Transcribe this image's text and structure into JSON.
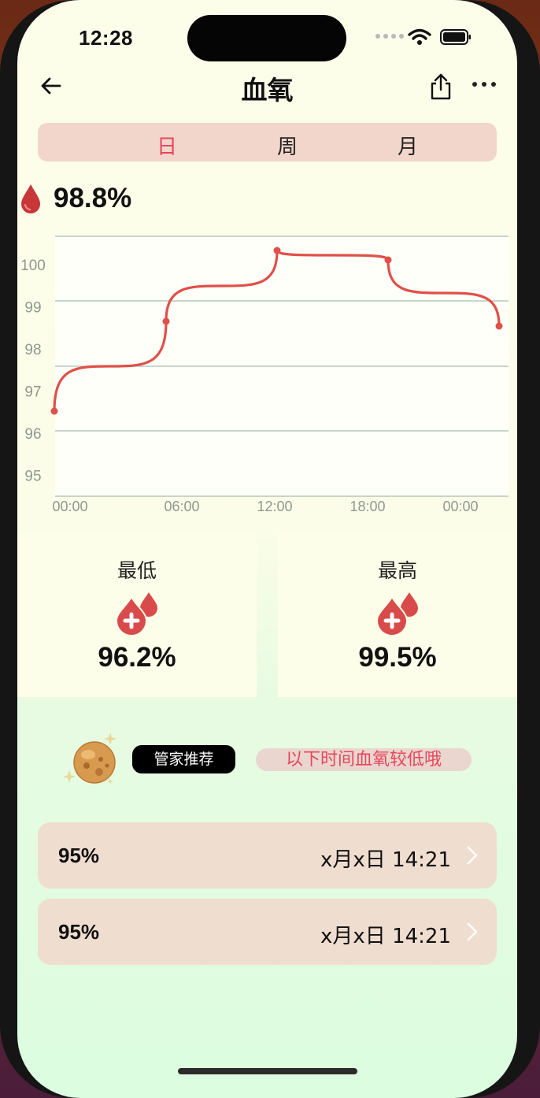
{
  "status_bar": {
    "time": "12:28"
  },
  "header": {
    "title": "血氧"
  },
  "tabs": [
    {
      "label": "日",
      "active": true
    },
    {
      "label": "周",
      "active": false
    },
    {
      "label": "月",
      "active": false
    }
  ],
  "current": {
    "value": "98.8%"
  },
  "chart_data": {
    "type": "line",
    "yticks": [
      "100",
      "99",
      "98",
      "97",
      "96",
      "95"
    ],
    "xticks": [
      "00:00",
      "06:00",
      "12:00",
      "18:00",
      "00:00"
    ],
    "ylim": [
      95,
      100.5
    ],
    "line_color": "#e05048",
    "series": [
      {
        "values": [
          96.8,
          98.7,
          100.2,
          100.0,
          98.6
        ]
      }
    ]
  },
  "stats": {
    "min": {
      "label": "最低",
      "value": "96.2%"
    },
    "max": {
      "label": "最高",
      "value": "99.5%"
    }
  },
  "recommend": {
    "badge": "管家推荐",
    "note": "以下时间血氧较低哦"
  },
  "records": [
    {
      "value": "95%",
      "time": "x月x日 14:21"
    },
    {
      "value": "95%",
      "time": "x月x日 14:21"
    }
  ],
  "colors": {
    "accent": "#e8445a",
    "drop": "#d94a4a",
    "tab_bg": "#f2d6cb",
    "row_bg": "#efddd0"
  }
}
